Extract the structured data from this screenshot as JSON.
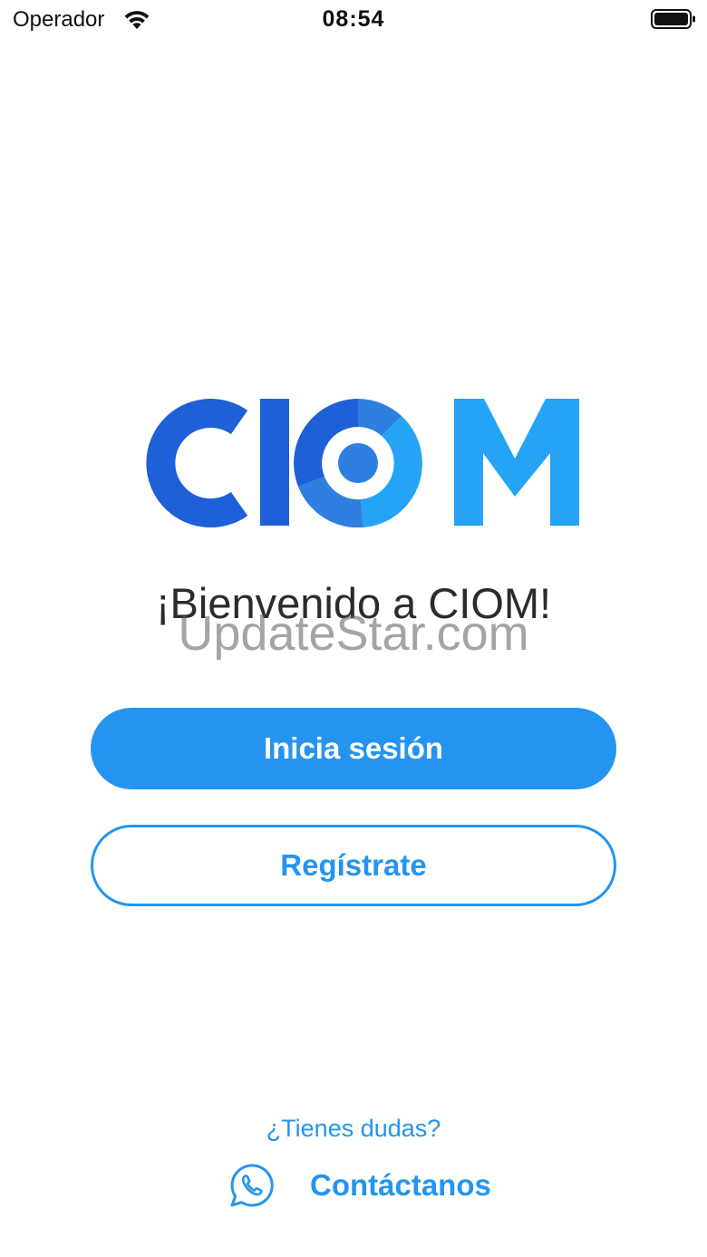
{
  "status_bar": {
    "carrier": "Operador",
    "time": "08:54",
    "icons": [
      "wifi-icon",
      "battery-icon"
    ]
  },
  "logo": {
    "text": "CIOM",
    "colors": {
      "dark_blue": "#1f5fd8",
      "mid_blue": "#2f7fe0",
      "light_blue": "#25a3f5"
    }
  },
  "welcome": {
    "title": "¡Bienvenido a CIOM!",
    "watermark": "UpdateStar.com"
  },
  "actions": {
    "login_label": "Inicia sesión",
    "register_label": "Regístrate"
  },
  "help": {
    "question": "¿Tienes dudas?",
    "contact_label": "Contáctanos",
    "contact_icon": "whatsapp-icon"
  },
  "theme": {
    "accent": "#2494f0",
    "background": "#ffffff",
    "text": "#2b2b2b"
  }
}
